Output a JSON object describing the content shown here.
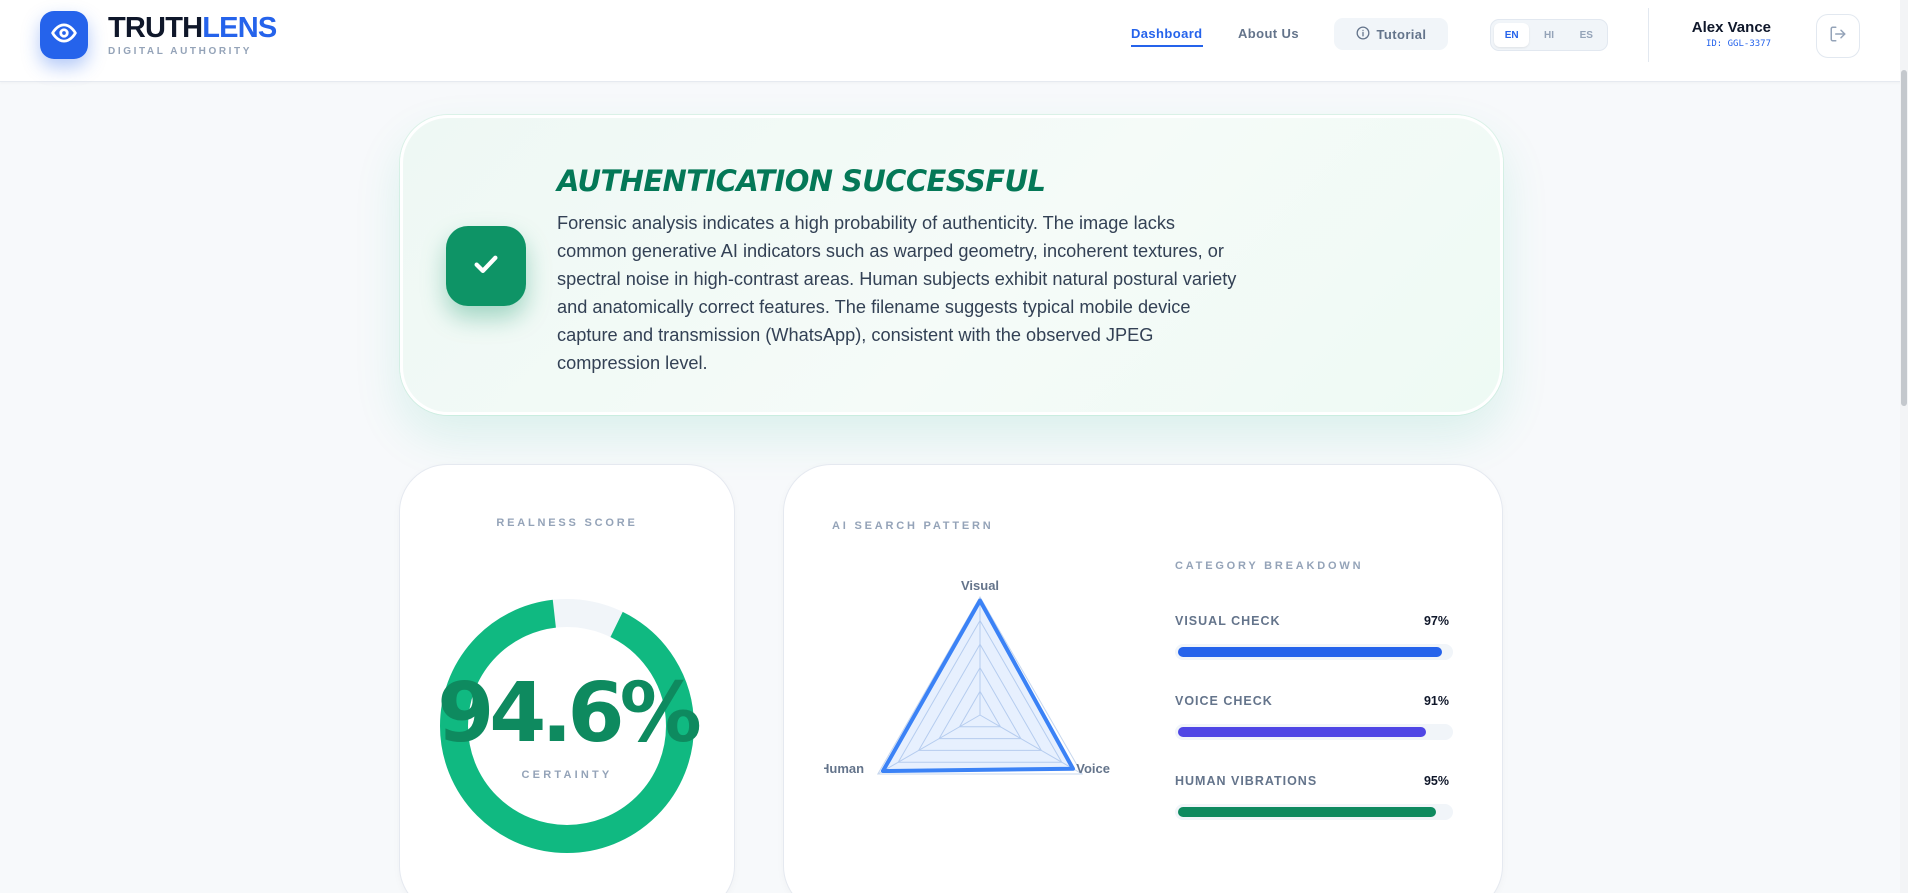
{
  "app": {
    "brand_primary": "TRUTH",
    "brand_accent": "LENS",
    "tagline": "DIGITAL AUTHORITY",
    "accent_color": "#2563eb",
    "success_color": "#0e9466"
  },
  "nav": {
    "items": [
      {
        "label": "Dashboard",
        "active": true
      },
      {
        "label": "About Us",
        "active": false
      }
    ],
    "tutorial_label": "Tutorial",
    "languages": [
      {
        "code": "EN",
        "active": true
      },
      {
        "code": "HI",
        "active": false
      },
      {
        "code": "ES",
        "active": false
      }
    ]
  },
  "user": {
    "name": "Alex Vance",
    "id": "ID: GGL-3377"
  },
  "banner": {
    "title": "AUTHENTICATION SUCCESSFUL",
    "text": "Forensic analysis indicates a high probability of authenticity. The image lacks common generative AI indicators such as warped geometry, incoherent textures, or spectral noise in high-contrast areas. Human subjects exhibit natural postural variety and anatomically correct features. The filename suggests typical mobile device capture and transmission (WhatsApp), consistent with the observed JPEG compression level.",
    "icon": "check-icon"
  },
  "score": {
    "title": "REALNESS SCORE",
    "value_text": "94.6%",
    "value": 94.6,
    "caption": "CERTAINTY",
    "color": "#10b981"
  },
  "pattern": {
    "title": "AI SEARCH PATTERN",
    "radar_labels": {
      "top": "Visual",
      "left": "Human",
      "right": "Voice"
    },
    "radar_values": {
      "visual": 97,
      "voice": 91,
      "human": 95
    },
    "breakdown_title": "CATEGORY BREAKDOWN",
    "items": [
      {
        "label": "VISUAL CHECK",
        "pct_text": "97%",
        "value": 97,
        "color": "#2563eb"
      },
      {
        "label": "VOICE CHECK",
        "pct_text": "91%",
        "value": 91,
        "color": "#4f46e5"
      },
      {
        "label": "HUMAN VIBRATIONS",
        "pct_text": "95%",
        "value": 95,
        "color": "#0e8a5f"
      }
    ]
  }
}
